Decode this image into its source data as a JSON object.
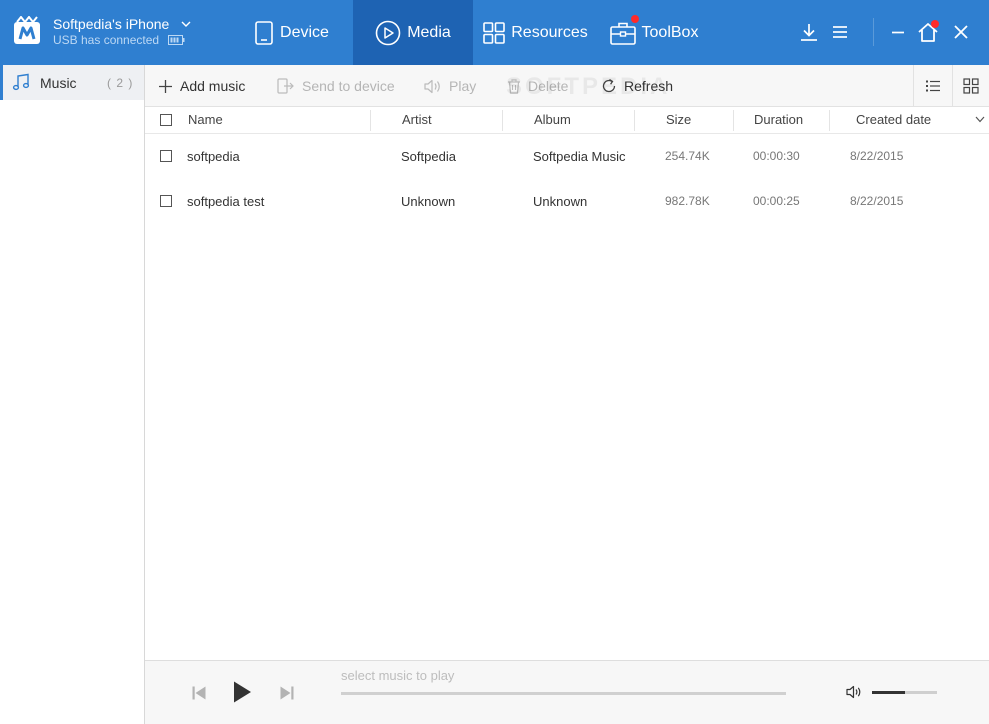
{
  "device": {
    "name": "Softpedia's iPhone",
    "status": "USB has connected"
  },
  "nav": {
    "device": "Device",
    "media": "Media",
    "resources": "Resources",
    "toolbox": "ToolBox"
  },
  "sidebar": {
    "items": [
      {
        "label": "Music",
        "count": "( 2 )"
      }
    ]
  },
  "toolbar": {
    "add": "Add music",
    "send": "Send to device",
    "play": "Play",
    "delete": "Delete",
    "refresh": "Refresh"
  },
  "watermark": "SOFTPEDIA",
  "table": {
    "columns": [
      "Name",
      "Artist",
      "Album",
      "Size",
      "Duration",
      "Created date"
    ],
    "rows": [
      {
        "name": "softpedia",
        "artist": "Softpedia",
        "album": "Softpedia Music",
        "size": "254.74K",
        "duration": "00:00:30",
        "created": "8/22/2015"
      },
      {
        "name": "softpedia test",
        "artist": "Unknown",
        "album": "Unknown",
        "size": "982.78K",
        "duration": "00:00:25",
        "created": "8/22/2015"
      }
    ]
  },
  "player": {
    "now_playing": "select music to play",
    "progress": 0,
    "volume": 0.5
  },
  "colors": {
    "header_bg": "#2f7fd0",
    "active_tab_bg": "#1e63b3",
    "notification_dot": "#ff2a2a"
  }
}
